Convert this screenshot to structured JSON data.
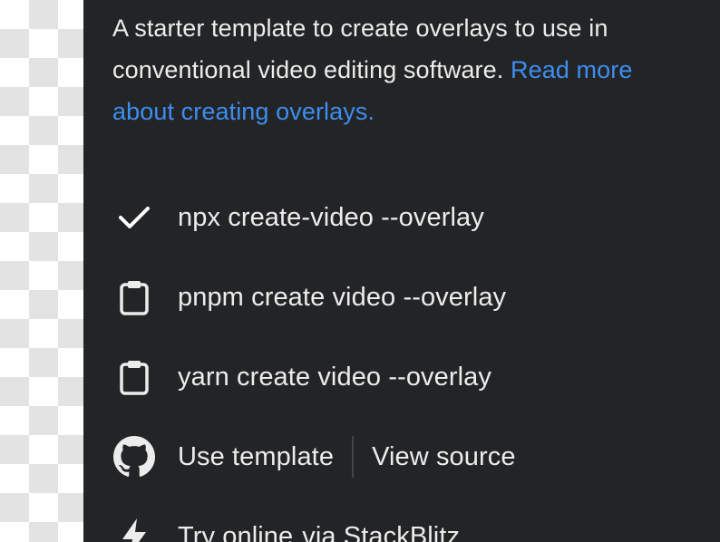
{
  "description": {
    "text": "A starter template to create overlays to use in conventional video editing software. ",
    "link_text": "Read more about creating overlays."
  },
  "commands": [
    {
      "text": "npx create-video --overlay",
      "icon": "check-icon",
      "copied": true
    },
    {
      "text": "pnpm create video --overlay",
      "icon": "clipboard-icon",
      "copied": false
    },
    {
      "text": "yarn create video --overlay",
      "icon": "clipboard-icon",
      "copied": false
    }
  ],
  "actions": {
    "icon": "github-icon",
    "use_template": "Use template",
    "view_source": "View source"
  },
  "try_online": {
    "icon": "lightning-icon",
    "label": "Try online",
    "via": "via StackBlitz"
  },
  "colors": {
    "panel_bg": "#232426",
    "text": "#ececec",
    "link": "#3d8ef0",
    "muted": "#8a8b8e"
  }
}
